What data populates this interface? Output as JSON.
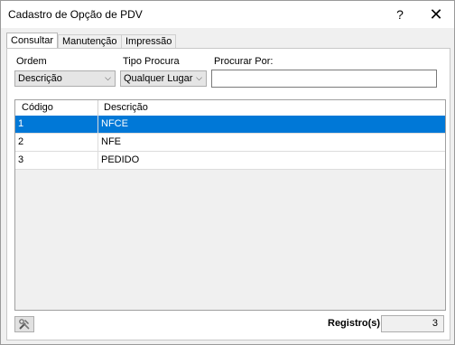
{
  "window": {
    "title": "Cadastro de Opção de PDV",
    "help_glyph": "?",
    "close_glyph": "✕"
  },
  "tabs": [
    {
      "label": "Consultar",
      "active": true
    },
    {
      "label": "Manutenção",
      "active": false
    },
    {
      "label": "Impressão",
      "active": false
    }
  ],
  "filters": {
    "ordem_label": "Ordem",
    "ordem_value": "Descrição",
    "tipo_label": "Tipo Procura",
    "tipo_value": "Qualquer Lugar",
    "procurar_label": "Procurar Por:",
    "procurar_value": ""
  },
  "grid": {
    "columns": [
      "Código",
      "Descrição"
    ],
    "rows": [
      {
        "codigo": "1",
        "descricao": "NFCE",
        "selected": true
      },
      {
        "codigo": "2",
        "descricao": "NFE",
        "selected": false
      },
      {
        "codigo": "3",
        "descricao": "PEDIDO",
        "selected": false
      }
    ]
  },
  "footer": {
    "tool_icon": "tools-icon",
    "registros_label": "Registro(s)",
    "registros_value": "3"
  },
  "colors": {
    "selection": "#0078d7",
    "panel": "#f0f0f0"
  }
}
